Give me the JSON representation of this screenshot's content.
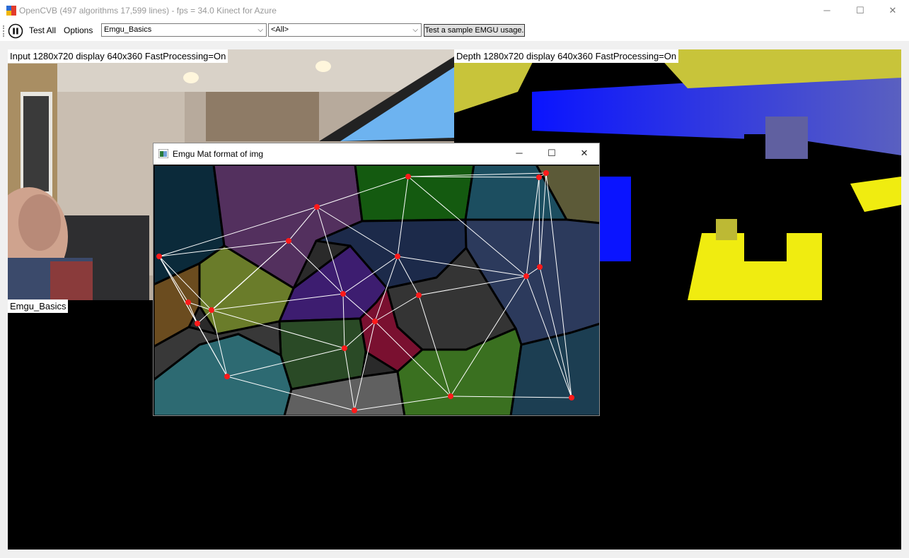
{
  "window": {
    "title": "OpenCVB (497 algorithms 17,599 lines) - fps = 34.0 Kinect for Azure",
    "minimize_glyph": "─",
    "maximize_glyph": "☐",
    "close_glyph": "✕"
  },
  "toolbar": {
    "pause_icon": "pause-icon",
    "test_all_label": "Test All",
    "options_label": "Options",
    "algorithm_select": "Emgu_Basics",
    "group_select": "<All>",
    "sample_button_label": "Test a sample EMGU usage.",
    "dropdown_glyph": "⌵"
  },
  "panels": {
    "input_label": "Input  1280x720  display  640x360  FastProcessing=On",
    "depth_label": "Depth  1280x720  display  640x360  FastProcessing=On",
    "algorithm_label": "Emgu_Basics"
  },
  "popup": {
    "title": "Emgu Mat format of img",
    "minimize_glyph": "─",
    "maximize_glyph": "☐",
    "close_glyph": "✕"
  },
  "colors": {
    "points": "#ff1a1a",
    "delaunay_lines": "#ffffff",
    "depth_blue": "#0a14ff",
    "depth_yellow": "#f0ec10"
  }
}
